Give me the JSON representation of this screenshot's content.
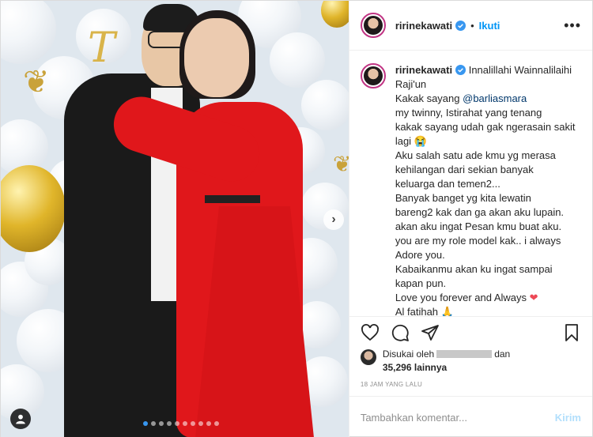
{
  "colors": {
    "accent": "#0095f6",
    "dress": "#e0171b",
    "heart": "#ed4956"
  },
  "header": {
    "username": "ririnekawati",
    "follow_label": "Ikuti",
    "separator": "•",
    "more_icon": "more-horizontal-icon"
  },
  "caption": {
    "username": "ririnekawati",
    "lines": [
      "Innalillahi Wainnalilaihi",
      "Raji'un",
      "Kakak sayang",
      "@barliasmara",
      "my twinny, Istirahat yang tenang",
      "kakak sayang udah gak ngerasain sakit",
      "lagi",
      "Aku salah satu ade kmu yg merasa",
      "kehilangan dari sekian banyak",
      "keluarga dan temen2...",
      "Banyak banget yg kita lewatin",
      "bareng2 kak dan ga akan aku lupain.",
      "akan aku ingat Pesan kmu buat aku.",
      "you are my role model kak.. i always",
      "Adore you.",
      "Kabaikanmu akan ku ingat sampai",
      "kapan pun.",
      "Love you forever and Always",
      "Al fatihah"
    ],
    "emoji_crying": "😭",
    "emoji_heart": "❤",
    "emoji_pray": "🙏"
  },
  "likes": {
    "prefix": "Disukai oleh",
    "suffix": "dan",
    "count": "35,296",
    "count_suffix": "lainnya"
  },
  "timestamp": "18 JAM YANG LALU",
  "comment": {
    "placeholder": "Tambahkan komentar...",
    "post_label": "Kirim"
  },
  "photo": {
    "next_icon": "›",
    "carousel_count": 10,
    "active_index": 0
  }
}
